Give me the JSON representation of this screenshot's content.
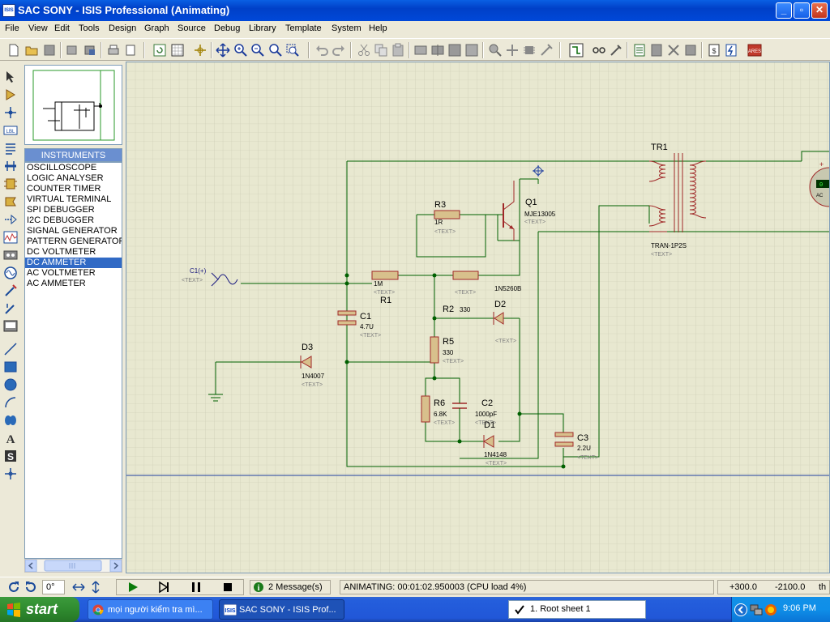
{
  "window": {
    "app_icon": "ISIS",
    "title": "SAC SONY - ISIS Professional (Animating)",
    "minimize_glyph": "_",
    "maximize_glyph": "▫",
    "close_glyph": "✕"
  },
  "menu": [
    "File",
    "View",
    "Edit",
    "Tools",
    "Design",
    "Graph",
    "Source",
    "Debug",
    "Library",
    "Template",
    "System",
    "Help"
  ],
  "instruments": {
    "header": "INSTRUMENTS",
    "items": [
      "OSCILLOSCOPE",
      "LOGIC ANALYSER",
      "COUNTER TIMER",
      "VIRTUAL TERMINAL",
      "SPI DEBUGGER",
      "I2C DEBUGGER",
      "SIGNAL GENERATOR",
      "PATTERN GENERATOR",
      "DC VOLTMETER",
      "DC AMMETER",
      "AC VOLTMETER",
      "AC AMMETER"
    ],
    "selected_index": 9
  },
  "toolstrip": {
    "lbl_text": "LBL",
    "text_tool": "A",
    "script_tool": "S"
  },
  "schematic": {
    "source_label": "C1(+)",
    "text_placeholder": "<TEXT>",
    "components": {
      "r1": {
        "ref": "R1",
        "value": "1M"
      },
      "r2": {
        "ref": "R2",
        "value": "330"
      },
      "r3": {
        "ref": "R3",
        "value": "1R"
      },
      "r5": {
        "ref": "R5",
        "value": "330"
      },
      "r6": {
        "ref": "R6",
        "value": "6.8K"
      },
      "c1": {
        "ref": "C1",
        "value": "4.7U"
      },
      "c2": {
        "ref": "C2",
        "value": "1000pF"
      },
      "c3": {
        "ref": "C3",
        "value": "2.2U"
      },
      "d1": {
        "ref": "D1",
        "value": "1N4148"
      },
      "d2": {
        "ref": "D2",
        "value": "1N5260B"
      },
      "d3": {
        "ref": "D3",
        "value": "1N4007"
      },
      "q1": {
        "ref": "Q1",
        "value": "MJE13005"
      },
      "tr1": {
        "ref": "TR1",
        "value": "TRAN-1P2S"
      }
    },
    "meter_plus": "+",
    "meter_reading": "0",
    "meter_unit": "AC"
  },
  "statusbar": {
    "rotation": "0°",
    "messages": "2 Message(s)",
    "animating": "ANIMATING: 00:01:02.950003 (CPU load 4%)",
    "coord_x": "+300.0",
    "coord_y": "-2100.0",
    "unit": "th"
  },
  "taskbar": {
    "start": "start",
    "tasks": [
      {
        "label": "mọi người kiểm tra mì...",
        "icon": "chrome-icon"
      },
      {
        "label": "SAC SONY - ISIS Prof...",
        "icon": "isis-icon",
        "active": true
      },
      {
        "label": "1. Root sheet 1",
        "icon": "check-icon"
      }
    ],
    "clock": "9:06 PM"
  },
  "colors": {
    "wire": "#006000",
    "component": "#A02828",
    "fill": "#D8C08C",
    "grid_bg": "#E8E8D0",
    "grid_line": "#C8C8B0"
  }
}
